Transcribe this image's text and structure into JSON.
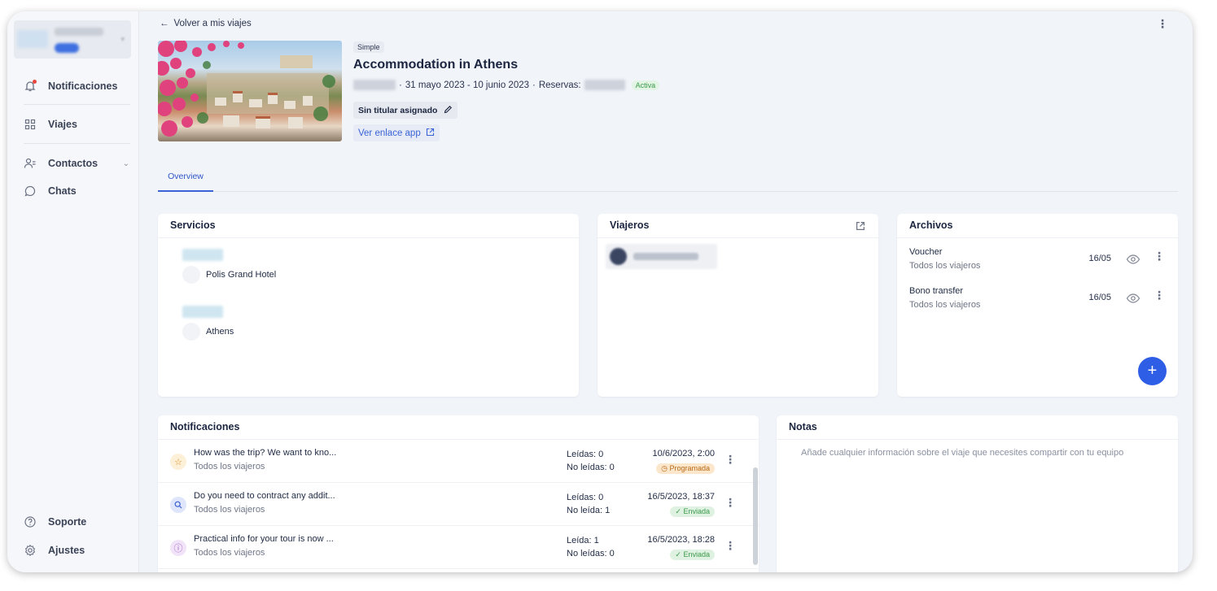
{
  "sidebar": {
    "items": [
      {
        "label": "Notificaciones",
        "icon": "bell-icon"
      },
      {
        "label": "Viajes",
        "icon": "grid-icon"
      },
      {
        "label": "Contactos",
        "icon": "contacts-icon"
      },
      {
        "label": "Chats",
        "icon": "chat-icon"
      },
      {
        "label": "Soporte",
        "icon": "help-icon"
      },
      {
        "label": "Ajustes",
        "icon": "settings-icon"
      }
    ]
  },
  "header": {
    "back_label": "Volver a mis viajes",
    "type_badge": "Simple",
    "title": "Accommodation in Athens",
    "separator": "·",
    "dates": "31 mayo 2023 - 10 junio 2023",
    "reservations_label": "Reservas:",
    "status": "Activa",
    "owner_label": "Sin titular asignado",
    "app_link_label": "Ver enlace app"
  },
  "tabs": [
    {
      "label": "Overview",
      "active": true
    }
  ],
  "services": {
    "title": "Servicios",
    "items": [
      {
        "name": "Polis Grand Hotel"
      },
      {
        "name": "Athens"
      }
    ]
  },
  "travelers": {
    "title": "Viajeros"
  },
  "files": {
    "title": "Archivos",
    "items": [
      {
        "name": "Voucher",
        "audience": "Todos los viajeros",
        "date": "16/05"
      },
      {
        "name": "Bono transfer",
        "audience": "Todos los viajeros",
        "date": "16/05"
      }
    ],
    "add_label": "+"
  },
  "notifications": {
    "title": "Notificaciones",
    "items": [
      {
        "title": "How was the trip? We want to kno...",
        "audience": "Todos los viajeros",
        "read": "Leídas: 0",
        "unread": "No leídas: 0",
        "date": "10/6/2023, 2:00",
        "status": "Programada",
        "icon": "star-icon"
      },
      {
        "title": "Do you need to contract any addit...",
        "audience": "Todos los viajeros",
        "read": "Leídas: 0",
        "unread": "No leída: 1",
        "date": "16/5/2023, 18:37",
        "status": "Enviada",
        "icon": "search-icon"
      },
      {
        "title": "Practical info for your tour is now ...",
        "audience": "Todos los viajeros",
        "read": "Leída: 1",
        "unread": "No leídas: 0",
        "date": "16/5/2023, 18:28",
        "status": "Enviada",
        "icon": "info-icon"
      }
    ]
  },
  "notes": {
    "title": "Notas",
    "placeholder": "Añade cualquier información sobre el viaje que necesites compartir con tu equipo"
  },
  "colors": {
    "accent": "#2f5ee6",
    "background": "#f1f4f9",
    "active_green": "#3a9b4b",
    "scheduled_orange": "#b86a16"
  }
}
